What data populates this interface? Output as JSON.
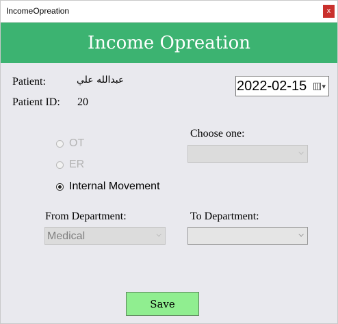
{
  "window": {
    "title": "IncomeOpreation",
    "close_glyph": "x"
  },
  "header": {
    "title": "Income Opreation"
  },
  "patient": {
    "name_label": "Patient:",
    "name_value": "عبدالله علي",
    "id_label": "Patient ID:",
    "id_value": "20"
  },
  "date_picker": {
    "value": "2022-02-15",
    "icon": "calendar-icon"
  },
  "options": [
    {
      "label": "OT",
      "checked": false,
      "enabled": false
    },
    {
      "label": "ER",
      "checked": false,
      "enabled": false
    },
    {
      "label": "Internal Movement",
      "checked": true,
      "enabled": true
    }
  ],
  "choose_one": {
    "label": "Choose one:",
    "value": ""
  },
  "from_department": {
    "label": "From Department:",
    "value": "Medical"
  },
  "to_department": {
    "label": "To Department:",
    "value": ""
  },
  "save_button": {
    "label": "Save"
  },
  "colors": {
    "header": "#3cb371",
    "save_button": "#90ee90",
    "close_button": "#c9302c"
  }
}
